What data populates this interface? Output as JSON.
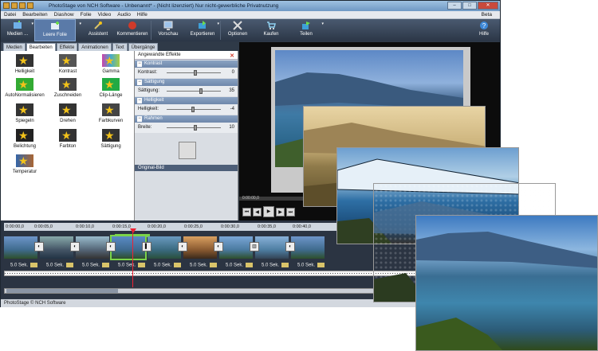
{
  "window": {
    "title": "PhotoStage von NCH Software - Unbenannt* - (Nicht lizenziert) Nur nicht-gewerbliche Privatnutzung"
  },
  "menu": {
    "items": [
      "Datei",
      "Bearbeiten",
      "Diashow",
      "Folie",
      "Video",
      "Audio",
      "Hilfe"
    ],
    "beta": "Beta"
  },
  "toolbar": {
    "items": [
      "Medien ...",
      "Leere Folie",
      "Assistent",
      "Kommentieren",
      "Vorschau",
      "Exportieren",
      "Optionen",
      "Kaufen",
      "Teilen",
      "Hilfe"
    ],
    "active": "Leere Folie"
  },
  "tabs": [
    "Medien",
    "Bearbeiten",
    "Effekte",
    "Animationen",
    "Text",
    "Übergänge"
  ],
  "selected_tab": "Bearbeiten",
  "effects": [
    "Helligkeit",
    "Kontrast",
    "Gamma",
    "AutoNormalisieren",
    "Zuschneiden",
    "Clip-Länge",
    "Spiegeln",
    "Drehen",
    "Farbkurven",
    "Belichtung",
    "Farbton",
    "Sättigung",
    "Temperatur"
  ],
  "applied": {
    "header": "Angewandte Effekte",
    "sections": [
      {
        "name": "Kontrast",
        "label": "Kontrast:",
        "value": "0",
        "level": 0.5
      },
      {
        "name": "Sättigung",
        "label": "Sättigung:",
        "value": "35",
        "level": 0.6
      },
      {
        "name": "Helligkeit",
        "label": "Helligkeit:",
        "value": "-4",
        "level": 0.45
      },
      {
        "name": "Rahmen",
        "label": "Breite:",
        "value": "10",
        "level": 0.5
      }
    ],
    "original": "Original-Bild"
  },
  "preview": {
    "time": "0:00:00,0"
  },
  "timeline": {
    "ruler": [
      "0:00:00,0",
      "0:00:05,0",
      "0:00:10,0",
      "0:00:15,0",
      "0:00:20,0",
      "0:00:25,0",
      "0:00:30,0",
      "0:00:35,0",
      "0:00:40,0"
    ],
    "durations": [
      "5.0 Sek.",
      "5.0 Sek.",
      "5.0 Sek.",
      "5.0 Sek.",
      "5.0 Sek.",
      "5.0 Sek.",
      "5.0 Sek.",
      "5.0 Sek.",
      "5.0 Sek."
    ]
  },
  "status": "PhotoStage © NCH Software",
  "colors": {
    "accent": "#5a7aa8",
    "star": "#f2c21a",
    "close": "#d03a2a"
  }
}
